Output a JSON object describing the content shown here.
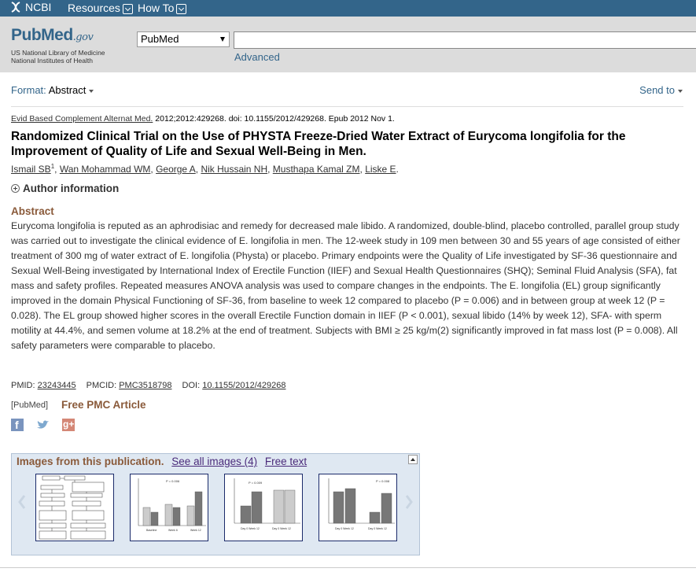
{
  "ncbi": {
    "logo_text": "NCBI",
    "menu": [
      {
        "label": "Resources"
      },
      {
        "label": "How To"
      }
    ]
  },
  "header": {
    "logo_main": "PubMed",
    "logo_gov": ".gov",
    "sub_line1": "US National Library of Medicine",
    "sub_line2": "National Institutes of Health",
    "database": "PubMed",
    "search_value": "",
    "advanced": "Advanced"
  },
  "toolbar": {
    "format_label": "Format:",
    "format_value": "Abstract",
    "send_to": "Send to"
  },
  "citation": {
    "journal": "Evid Based Complement Alternat Med.",
    "details": "2012;2012:429268. doi: 10.1155/2012/429268. Epub 2012 Nov 1."
  },
  "article": {
    "title": "Randomized Clinical Trial on the Use of PHYSTA Freeze-Dried Water Extract of Eurycoma longifolia for the Improvement of Quality of Life and Sexual Well-Being in Men.",
    "authors": [
      "Ismail SB",
      "Wan Mohammad WM",
      "George A",
      "Nik Hussain NH",
      "Musthapa Kamal ZM",
      "Liske E"
    ],
    "author_sup": "1",
    "author_info": "Author information",
    "abstract_heading": "Abstract",
    "abstract": "Eurycoma longifolia is reputed as an aphrodisiac and remedy for decreased male libido. A randomized, double-blind, placebo controlled, parallel group study was carried out to investigate the clinical evidence of E. longifolia in men. The 12-week study in 109 men between 30 and 55 years of age consisted of either treatment of 300 mg of water extract of E. longifolia (Physta) or placebo. Primary endpoints were the Quality of Life investigated by SF-36 questionnaire and Sexual Well-Being investigated by International Index of Erectile Function (IIEF) and Sexual Health Questionnaires (SHQ); Seminal Fluid Analysis (SFA), fat mass and safety profiles. Repeated measures ANOVA analysis was used to compare changes in the endpoints. The E. longifolia (EL) group significantly improved in the domain Physical Functioning of SF-36, from baseline to week 12 compared to placebo (P = 0.006) and in between group at week 12 (P = 0.028). The EL group showed higher scores in the overall Erectile Function domain in IIEF (P < 0.001), sexual libido (14% by week 12), SFA- with sperm motility at 44.4%, and semen volume at 18.2% at the end of treatment. Subjects with BMI ≥ 25 kg/m(2) significantly improved in fat mass lost (P = 0.008). All safety parameters were comparable to placebo."
  },
  "ids": {
    "pmid_label": "PMID:",
    "pmid": "23243445",
    "pmcid_label": "PMCID:",
    "pmcid": "PMC3518798",
    "doi_label": "DOI:",
    "doi": "10.1155/2012/429268",
    "source_tag": "[PubMed]",
    "free_pmc": "Free PMC Article"
  },
  "social": [
    "facebook-icon",
    "twitter-icon",
    "google-plus-icon"
  ],
  "images": {
    "heading": "Images from this publication.",
    "see_all": "See all images (4)",
    "free_text": "Free text"
  },
  "colors": {
    "ncbi_bar": "#33658a",
    "header_bg": "#dcdcdc",
    "brown_heading": "#8a5a3a",
    "images_bg": "#dfe8f2"
  }
}
